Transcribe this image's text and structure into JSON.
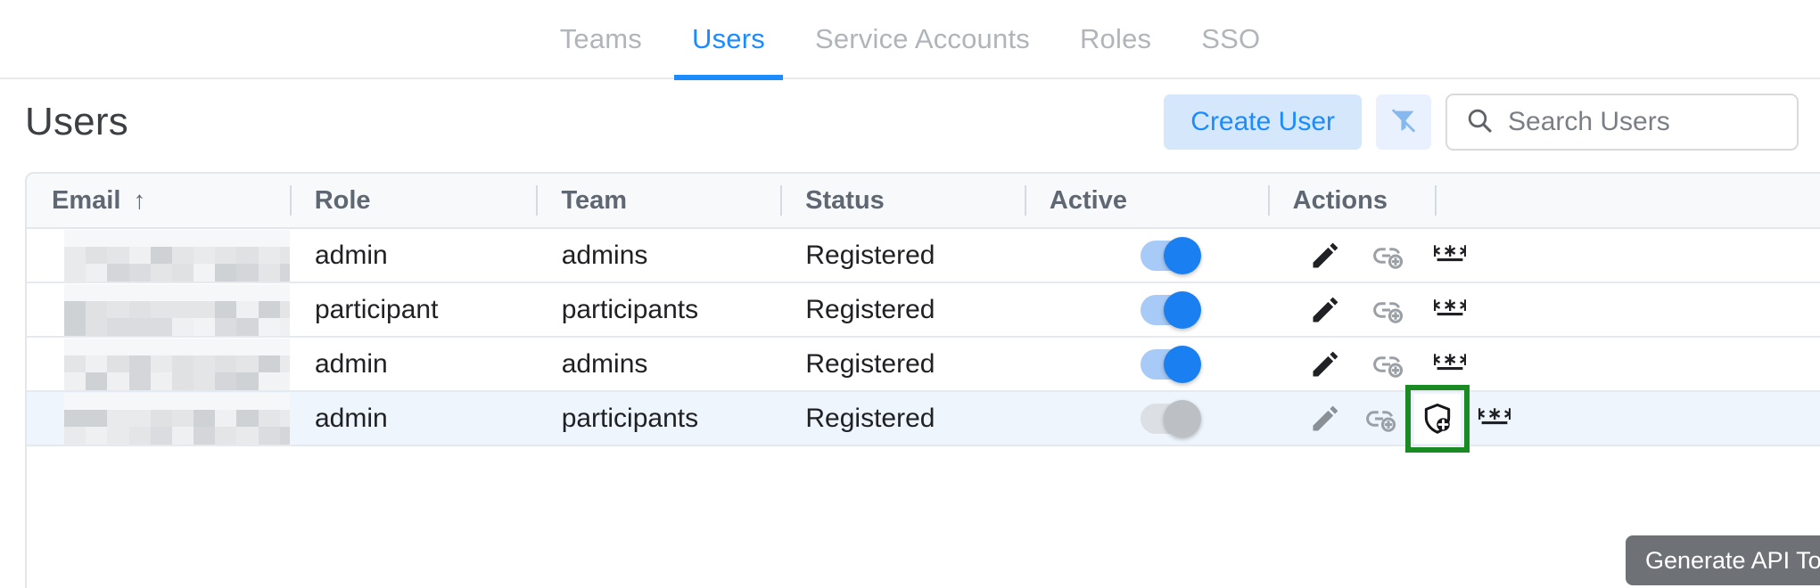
{
  "tabs": [
    {
      "label": "Teams",
      "active": false
    },
    {
      "label": "Users",
      "active": true
    },
    {
      "label": "Service Accounts",
      "active": false
    },
    {
      "label": "Roles",
      "active": false
    },
    {
      "label": "SSO",
      "active": false
    }
  ],
  "header": {
    "title": "Users",
    "create_button": "Create User",
    "filter_icon": "funnel-clear-icon",
    "search": {
      "placeholder": "Search Users",
      "value": "",
      "icon": "search-icon"
    }
  },
  "table": {
    "columns": [
      {
        "key": "email",
        "label": "Email",
        "sorted": true,
        "sort_dir": "↑"
      },
      {
        "key": "role",
        "label": "Role",
        "sorted": false
      },
      {
        "key": "team",
        "label": "Team",
        "sorted": false
      },
      {
        "key": "status",
        "label": "Status",
        "sorted": false
      },
      {
        "key": "active",
        "label": "Active",
        "sorted": false
      },
      {
        "key": "actions",
        "label": "Actions",
        "sorted": false
      }
    ],
    "rows": [
      {
        "email": "",
        "email_redacted": true,
        "role": "admin",
        "team": "admins",
        "status": "Registered",
        "active": true,
        "selected": false,
        "actions": [
          "edit-pencil-icon",
          "link-add-icon",
          "password-asterisks-icon"
        ]
      },
      {
        "email": "",
        "email_redacted": true,
        "role": "participant",
        "team": "participants",
        "status": "Registered",
        "active": true,
        "selected": false,
        "actions": [
          "edit-pencil-icon",
          "link-add-icon",
          "password-asterisks-icon"
        ]
      },
      {
        "email": "",
        "email_redacted": true,
        "role": "admin",
        "team": "admins",
        "status": "Registered",
        "active": true,
        "selected": false,
        "actions": [
          "edit-pencil-icon",
          "link-add-icon",
          "password-asterisks-icon"
        ]
      },
      {
        "email": "",
        "email_redacted": true,
        "role": "admin",
        "team": "participants",
        "status": "Registered",
        "active": false,
        "selected": true,
        "actions": [
          "edit-pencil-icon",
          "link-add-icon",
          "shield-plus-icon",
          "password-asterisks-icon"
        ]
      }
    ]
  },
  "tooltip": {
    "text": "Generate API Token"
  },
  "highlight": {
    "target_icon": "shield-plus-icon",
    "color": "#1a8a23"
  },
  "colors": {
    "accent": "#1a8cff",
    "create_button_bg": "#d5e7fb",
    "selected_row_bg": "#eef5fd",
    "header_bg": "#f7f9fb",
    "tooltip_bg": "#6e7175",
    "toggle_on": "#1a7ff0",
    "toggle_off": "#bcc0c4"
  }
}
